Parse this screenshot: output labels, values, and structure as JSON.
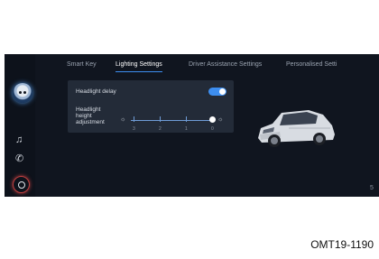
{
  "sidebar": {
    "assistant_icon": "assistant-avatar-icon",
    "items": [
      {
        "icon": "music-note-icon",
        "glyph": "♫"
      },
      {
        "icon": "phone-icon",
        "glyph": "✆"
      },
      {
        "icon": "home-icon"
      }
    ],
    "accent_color": "#c24040"
  },
  "tabs": [
    {
      "label": "Smart Key",
      "active": false
    },
    {
      "label": "Lighting Settings",
      "active": true
    },
    {
      "label": "Driver Assistance Settings",
      "active": false
    },
    {
      "label": "Personalised Setti",
      "active": false
    }
  ],
  "lighting": {
    "headlight_delay": {
      "label": "Headlight delay",
      "enabled": true
    },
    "height_adjustment": {
      "label": "Headlight height adjustment",
      "ticks": [
        "3",
        "2",
        "1",
        "0"
      ],
      "selected": "0"
    }
  },
  "page_indicator": "5",
  "caption": "OMT19-1190",
  "colors": {
    "accent": "#3d8ef0",
    "background": "#10151f",
    "panel": "#232b38"
  }
}
